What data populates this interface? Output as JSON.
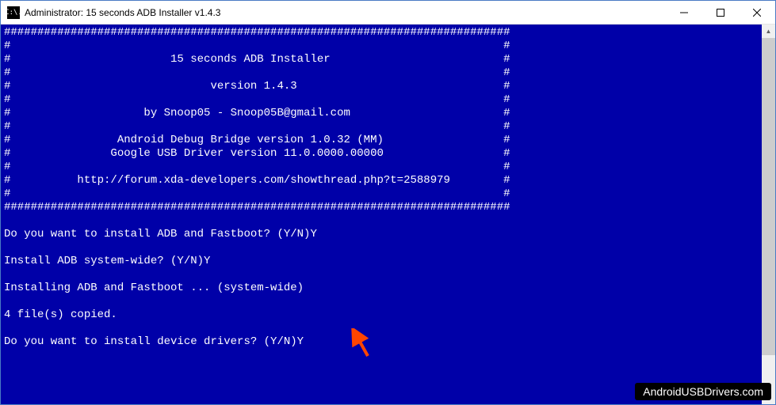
{
  "window": {
    "title": "Administrator:  15 seconds ADB Installer v1.4.3",
    "icon_label": "C:\\."
  },
  "console": {
    "lines": [
      "############################################################################",
      "#                                                                          #",
      "#                        15 seconds ADB Installer                          #",
      "#                                                                          #",
      "#                              version 1.4.3                               #",
      "#                                                                          #",
      "#                    by Snoop05 - Snoop05B@gmail.com                       #",
      "#                                                                          #",
      "#                Android Debug Bridge version 1.0.32 (MM)                  #",
      "#               Google USB Driver version 11.0.0000.00000                  #",
      "#                                                                          #",
      "#          http://forum.xda-developers.com/showthread.php?t=2588979        #",
      "#                                                                          #",
      "############################################################################",
      "",
      "Do you want to install ADB and Fastboot? (Y/N)Y",
      "",
      "Install ADB system-wide? (Y/N)Y",
      "",
      "Installing ADB and Fastboot ... (system-wide)",
      "",
      "4 file(s) copied.",
      "",
      "Do you want to install device drivers? (Y/N)Y"
    ]
  },
  "watermark": {
    "text": "AndroidUSBDrivers.com"
  }
}
